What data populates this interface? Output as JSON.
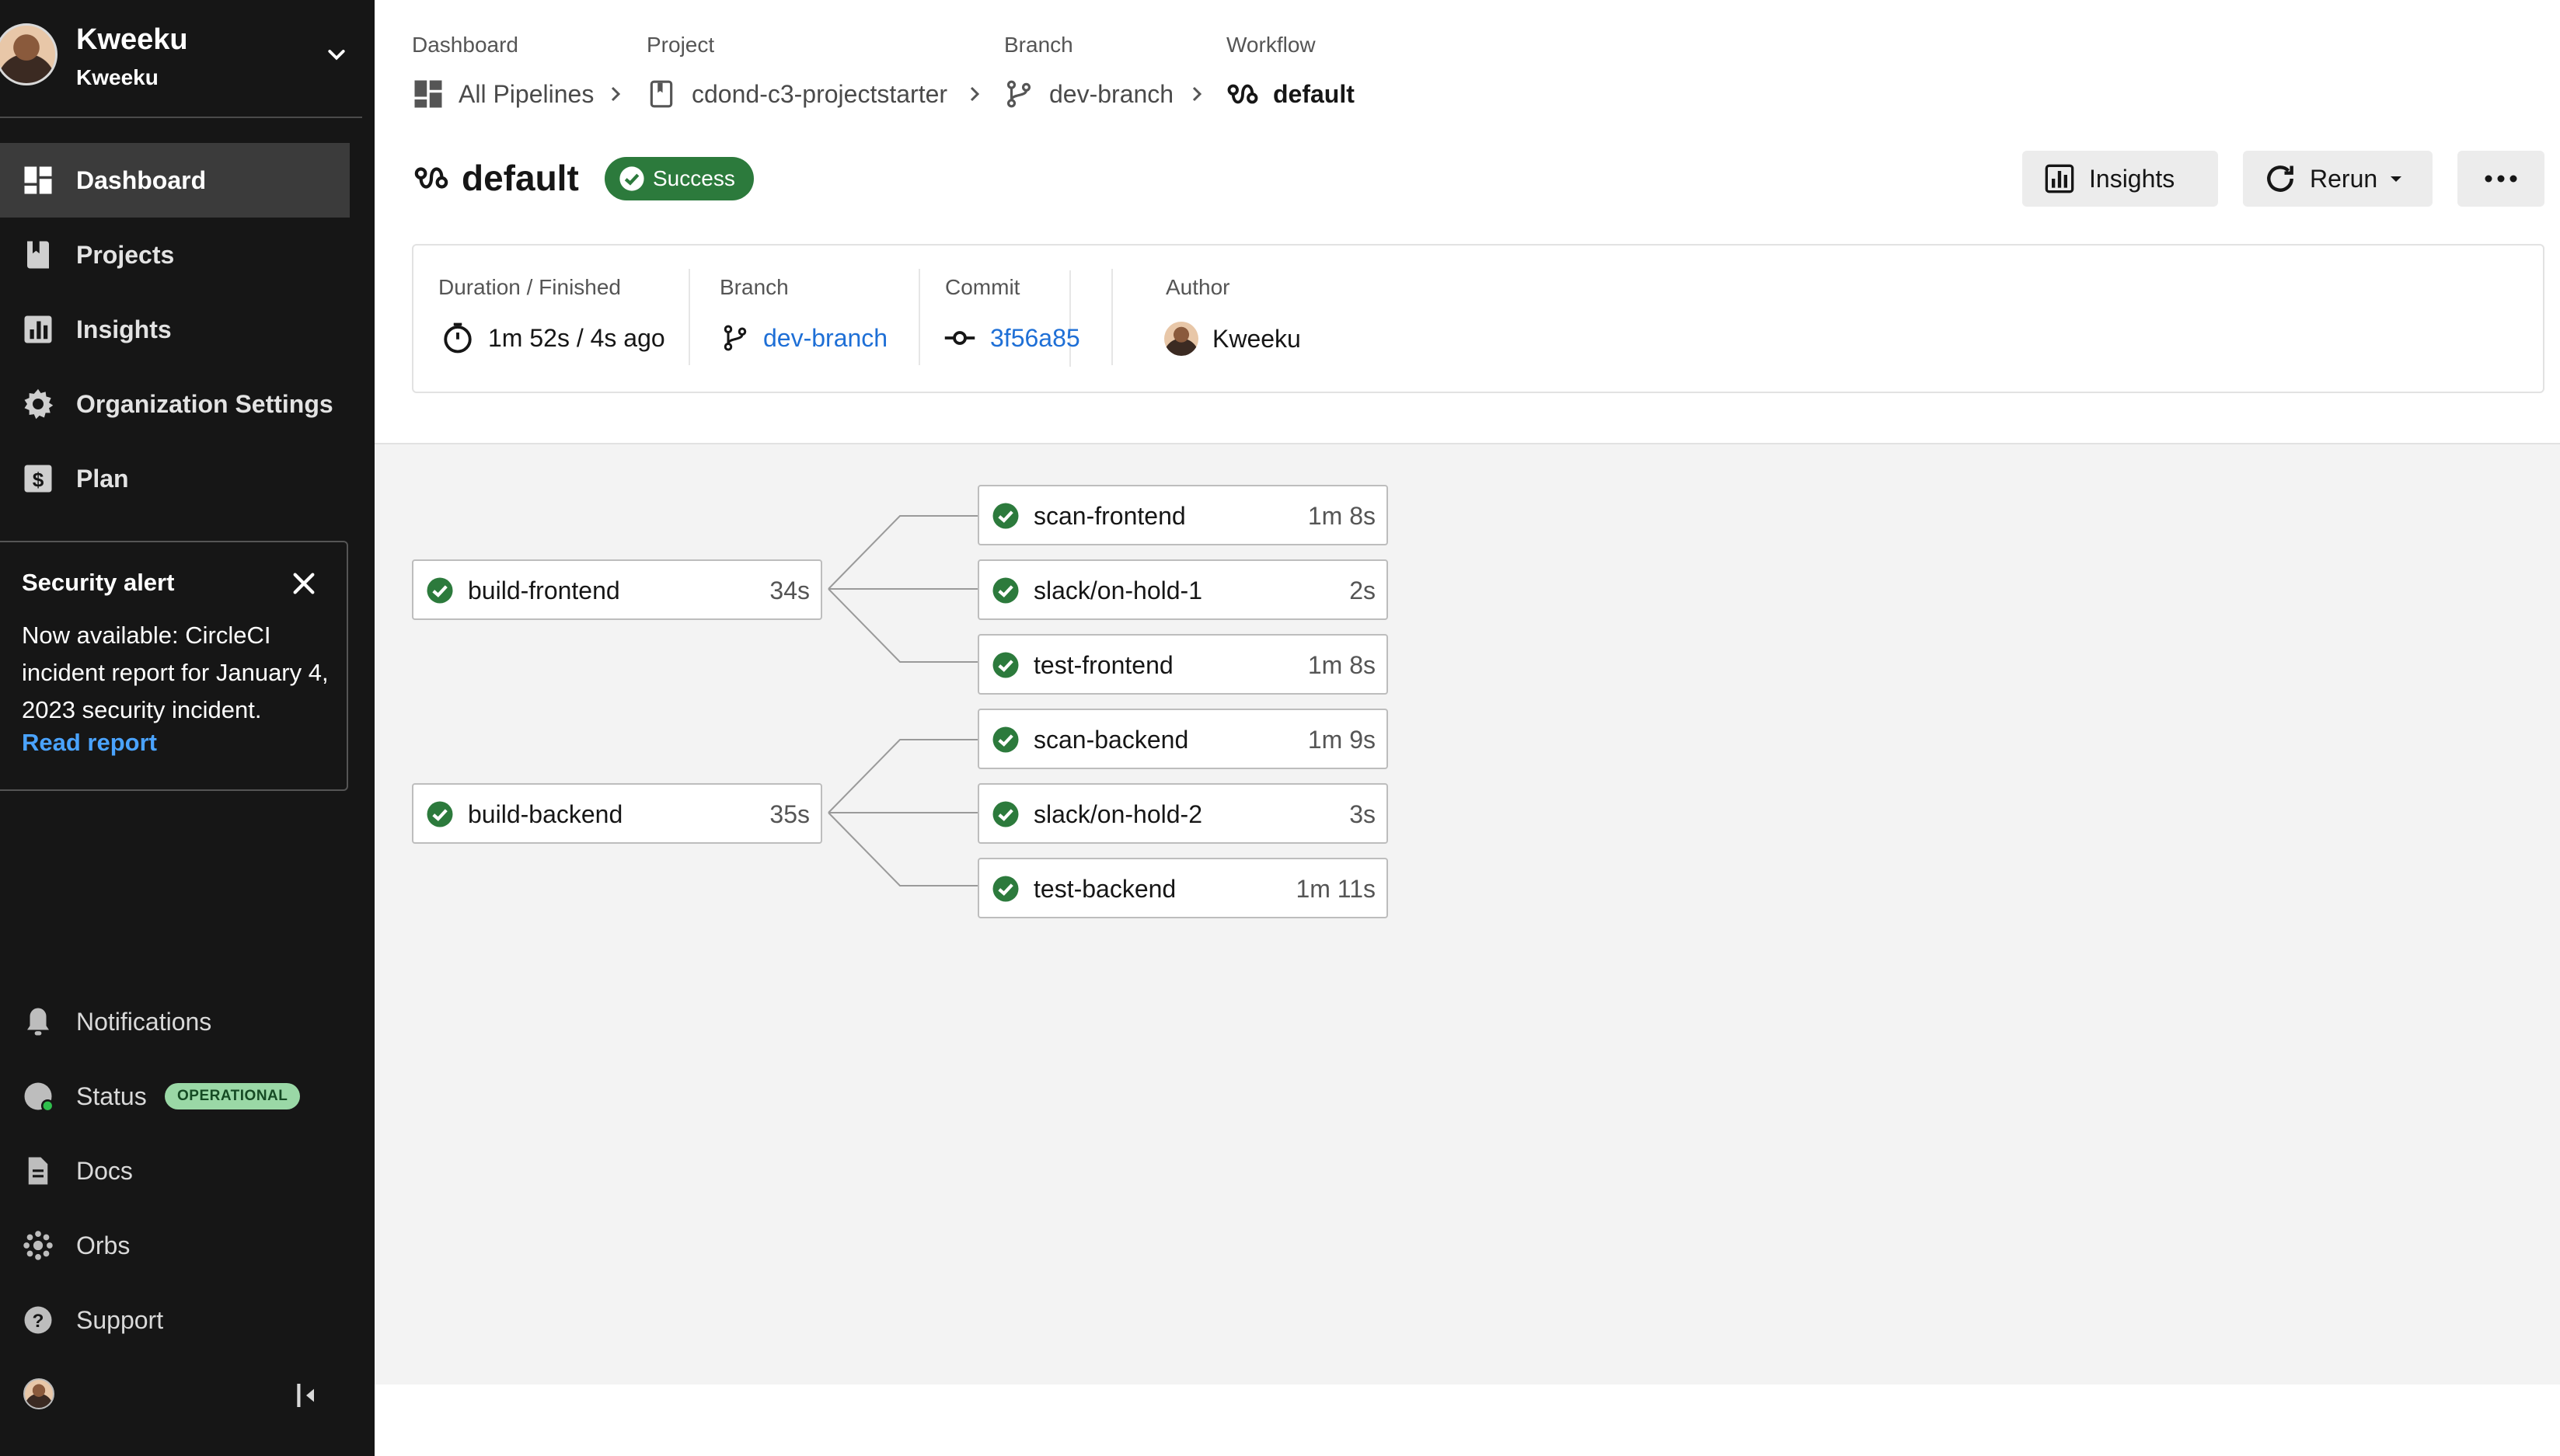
{
  "user": {
    "name": "Kweeku",
    "org": "Kweeku"
  },
  "nav": [
    {
      "label": "Dashboard",
      "icon": "dashboard-icon",
      "active": true
    },
    {
      "label": "Projects",
      "icon": "projects-icon"
    },
    {
      "label": "Insights",
      "icon": "insights-icon"
    },
    {
      "label": "Organization Settings",
      "icon": "gear-icon"
    },
    {
      "label": "Plan",
      "icon": "dollar-icon"
    }
  ],
  "alert": {
    "title": "Security alert",
    "body": "Now available: CircleCI incident report for January 4, 2023 security incident.",
    "link": "Read report"
  },
  "bottom_nav": [
    {
      "label": "Notifications",
      "icon": "bell-icon"
    },
    {
      "label": "Status",
      "icon": "status-icon",
      "badge": "OPERATIONAL"
    },
    {
      "label": "Docs",
      "icon": "docs-icon"
    },
    {
      "label": "Orbs",
      "icon": "orbs-icon"
    },
    {
      "label": "Support",
      "icon": "help-icon"
    }
  ],
  "breadcrumb": [
    {
      "label": "Dashboard",
      "value": "All Pipelines"
    },
    {
      "label": "Project",
      "value": "cdond-c3-projectstarter"
    },
    {
      "label": "Branch",
      "value": "dev-branch"
    },
    {
      "label": "Workflow",
      "value": "default"
    }
  ],
  "workflow": {
    "title": "default",
    "status": "Success",
    "actions": {
      "insights": "Insights",
      "rerun": "Rerun"
    }
  },
  "info": {
    "duration_label": "Duration / Finished",
    "duration_value": "1m 52s / 4s ago",
    "branch_label": "Branch",
    "branch_value": "dev-branch",
    "commit_label": "Commit",
    "commit_value": "3f56a85",
    "author_label": "Author",
    "author_value": "Kweeku"
  },
  "jobs": {
    "build_frontend": {
      "name": "build-frontend",
      "duration": "34s"
    },
    "build_backend": {
      "name": "build-backend",
      "duration": "35s"
    },
    "scan_frontend": {
      "name": "scan-frontend",
      "duration": "1m 8s"
    },
    "slack_hold_1": {
      "name": "slack/on-hold-1",
      "duration": "2s"
    },
    "test_frontend": {
      "name": "test-frontend",
      "duration": "1m 8s"
    },
    "scan_backend": {
      "name": "scan-backend",
      "duration": "1m 9s"
    },
    "slack_hold_2": {
      "name": "slack/on-hold-2",
      "duration": "3s"
    },
    "test_backend": {
      "name": "test-backend",
      "duration": "1m 11s"
    }
  },
  "colors": {
    "sidebar": "#161616",
    "success": "#2c7a3c",
    "link": "#1e6fd6",
    "status_badge": "#9ad8a6"
  }
}
